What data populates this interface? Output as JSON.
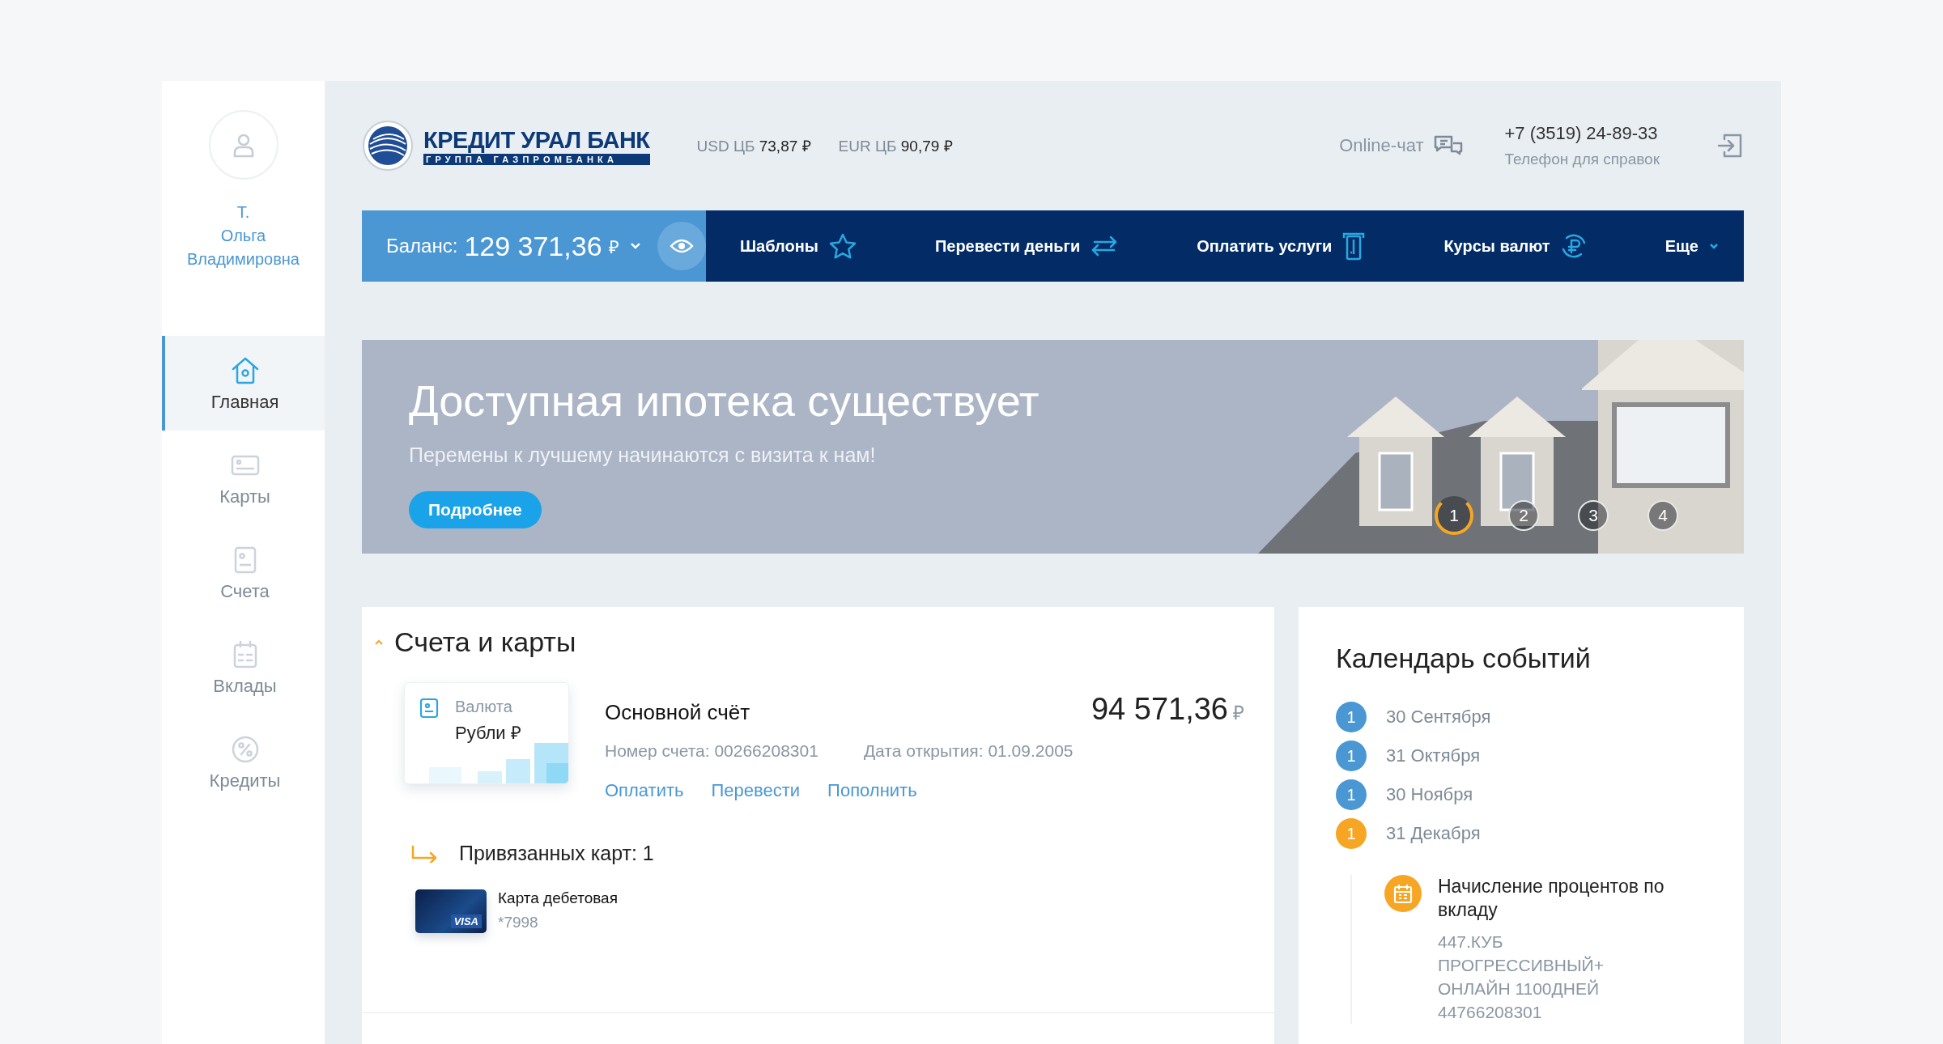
{
  "user": {
    "name_lines": [
      "Т.",
      "Ольга",
      "Владимировна"
    ]
  },
  "sidebar": {
    "items": [
      {
        "label": "Главная",
        "kind": "home",
        "selected": true
      },
      {
        "label": "Карты",
        "kind": "card",
        "selected": false
      },
      {
        "label": "Счета",
        "kind": "account",
        "selected": false
      },
      {
        "label": "Вклады",
        "kind": "calendar",
        "selected": false
      },
      {
        "label": "Кредиты",
        "kind": "percent",
        "selected": false
      }
    ]
  },
  "header": {
    "logo": {
      "title": "КРЕДИТ УРАЛ БАНК",
      "subtitle": "ГРУППА ГАЗПРОМБАНКА"
    },
    "rates": [
      {
        "label": "USD ЦБ",
        "value": "73,87 ₽"
      },
      {
        "label": "EUR ЦБ",
        "value": "90,79 ₽"
      }
    ],
    "chat": "Online-чат",
    "phone": {
      "number": "+7 (3519) 24-89-33",
      "caption": "Телефон для справок"
    }
  },
  "navbar": {
    "balance": {
      "label": "Баланс:",
      "amount": "129 371,36",
      "currency": "₽"
    },
    "items": [
      {
        "label": "Шаблоны",
        "kind": "star"
      },
      {
        "label": "Перевести деньги",
        "kind": "transfer"
      },
      {
        "label": "Оплатить услуги",
        "kind": "terminal"
      },
      {
        "label": "Курсы валют",
        "kind": "ruble"
      },
      {
        "label": "Еще",
        "kind": "caret"
      }
    ]
  },
  "banner": {
    "title": "Доступная ипотека существует",
    "subtitle": "Перемены к лучшему начинаются с визита к нам!",
    "button": "Подробнее",
    "slides": [
      {
        "label": "1",
        "selected": true
      },
      {
        "label": "2",
        "selected": false
      },
      {
        "label": "3",
        "selected": false
      },
      {
        "label": "4",
        "selected": false
      }
    ]
  },
  "accounts": {
    "title": "Счета и карты",
    "expanded": true,
    "account": {
      "currency_label": "Валюта",
      "currency": "Рубли ₽",
      "name": "Основной счёт",
      "amount": "94 571,36",
      "currency_sign": "₽",
      "number": "Номер счета: 00266208301",
      "opened": "Дата открытия: 01.09.2005",
      "actions": [
        "Оплатить",
        "Перевести",
        "Пополнить"
      ]
    },
    "linked_title": "Привязанных карт: 1",
    "cards": [
      {
        "name": "Карта дебетовая",
        "number": "*7998",
        "brand": "VISA"
      }
    ]
  },
  "calendar": {
    "title": "Календарь событий",
    "dates": [
      {
        "count": "1",
        "date": "30 Сентября",
        "color": "#4a97d4"
      },
      {
        "count": "1",
        "date": "31 Октября",
        "color": "#4a97d4"
      },
      {
        "count": "1",
        "date": "30 Ноября",
        "color": "#4a97d4"
      },
      {
        "count": "1",
        "date": "31 Декабря",
        "color": "#f6a623"
      }
    ],
    "event": {
      "title": "Начисление процентов по вкладу",
      "detail": "447.КУБ ПРОГРЕССИВНЫЙ+ ОНЛАЙН 1100ДНЕЙ 44766208301"
    }
  }
}
